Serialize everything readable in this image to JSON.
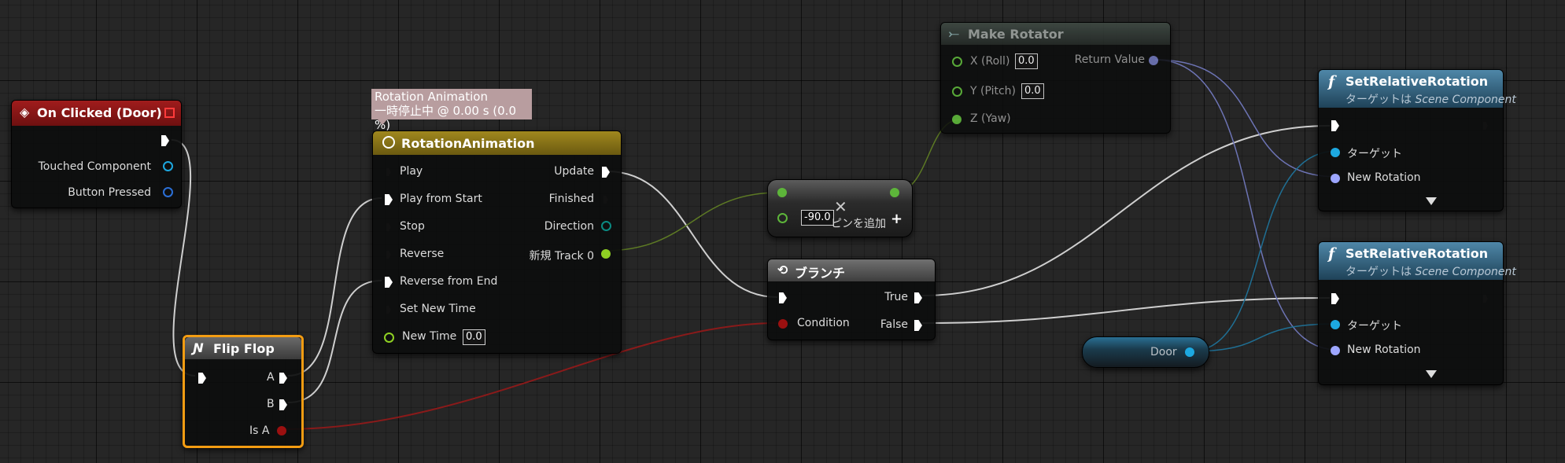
{
  "colors": {
    "background": "#262626",
    "exec_pin": "#ffffff",
    "object_pin": "#1da8e0",
    "bool_pin": "#9b1010",
    "float_pin": "#8fd023",
    "rotator_pin": "#9da6ff",
    "event_header": "#8c1515",
    "timeline_header": "#8a7517",
    "function_header": "#3f6f8c",
    "flipflop_border": "#f39c12"
  },
  "comment": {
    "line1": "Rotation Animation",
    "line2": "一時停止中 @ 0.00 s (0.0 %)"
  },
  "event_node": {
    "title": "On Clicked (Door)",
    "icon": "event-diamond-icon",
    "pins": {
      "touched": "Touched Component",
      "button": "Button Pressed"
    }
  },
  "flipflop": {
    "title": "Flip Flop",
    "icon": "flipflop-icon",
    "pins": {
      "a": "A",
      "b": "B",
      "is_a": "Is A"
    }
  },
  "timeline": {
    "title": "RotationAnimation",
    "icon": "clock-icon",
    "inputs": {
      "play": "Play",
      "play_start": "Play from Start",
      "stop": "Stop",
      "reverse": "Reverse",
      "reverse_end": "Reverse from End",
      "set_new_time": "Set New Time",
      "new_time": "New Time",
      "new_time_value": "0.0"
    },
    "outputs": {
      "update": "Update",
      "finished": "Finished",
      "direction": "Direction",
      "track": "新規 Track 0"
    }
  },
  "multiply": {
    "value": "-90.0",
    "add_pin": "ピンを追加",
    "add_icon": "plus-icon",
    "op_icon": "multiply-icon"
  },
  "branch": {
    "title": "ブランチ",
    "icon": "branch-icon",
    "pins": {
      "condition": "Condition",
      "true": "True",
      "false": "False"
    }
  },
  "make_rotator": {
    "title": "Make Rotator",
    "icon": "make-struct-icon",
    "pins": {
      "x": "X (Roll)",
      "x_value": "0.0",
      "y": "Y (Pitch)",
      "y_value": "0.0",
      "z": "Z (Yaw)",
      "ret": "Return Value"
    }
  },
  "set_rot_1": {
    "title": "SetRelativeRotation",
    "subtitle_prefix": "ターゲットは",
    "subtitle_target": "Scene Component",
    "icon": "function-icon",
    "pins": {
      "target": "ターゲット",
      "new_rotation": "New Rotation"
    }
  },
  "set_rot_2": {
    "title": "SetRelativeRotation",
    "subtitle_prefix": "ターゲットは",
    "subtitle_target": "Scene Component",
    "icon": "function-icon",
    "pins": {
      "target": "ターゲット",
      "new_rotation": "New Rotation"
    }
  },
  "door_var": {
    "label": "Door"
  }
}
